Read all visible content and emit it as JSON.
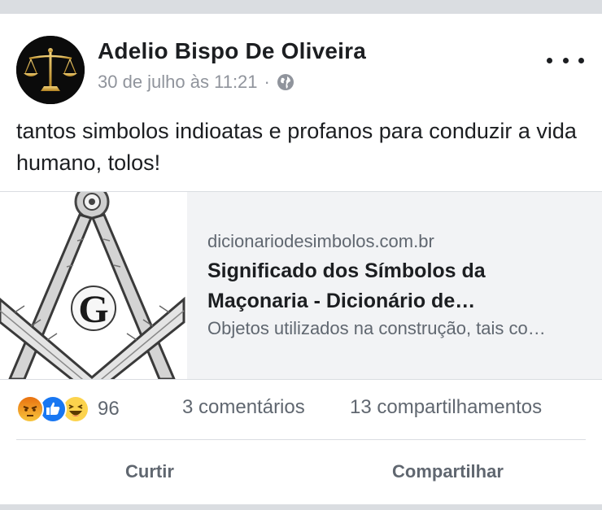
{
  "post": {
    "author": "Adelio Bispo De Oliveira",
    "timestamp": "30 de julho às 11:21",
    "separator": "·",
    "privacy_icon": "globe-icon",
    "text": "tantos simbolos indioatas e profanos para conduzir a vida humano, tolos!"
  },
  "link_preview": {
    "domain": "dicionariodesimbolos.com.br",
    "title": "Significado dos Símbolos da Maçonaria - Dicionário de…",
    "description": "Objetos utilizados na construção, tais co…",
    "thumbnail_letter": "G"
  },
  "stats": {
    "reaction_icons": [
      "angry-icon",
      "like-icon",
      "haha-icon"
    ],
    "reaction_count": "96",
    "comments": "3 comentários",
    "shares": "13 compartilhamentos"
  },
  "actions": {
    "like_label": "Curtir",
    "share_label": "Compartilhar"
  },
  "colors": {
    "text_primary": "#1c1e21",
    "text_secondary": "#606770",
    "link_background": "#f2f3f5",
    "like_blue": "#1877f2",
    "angry_orange": "#e9710f",
    "haha_yellow": "#fcd34d"
  }
}
